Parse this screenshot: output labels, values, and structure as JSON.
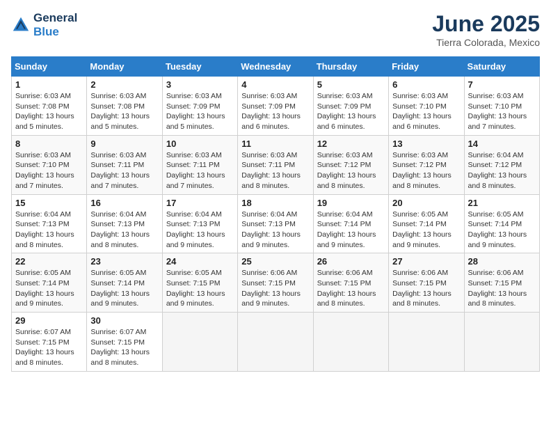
{
  "header": {
    "logo_line1": "General",
    "logo_line2": "Blue",
    "month": "June 2025",
    "location": "Tierra Colorada, Mexico"
  },
  "weekdays": [
    "Sunday",
    "Monday",
    "Tuesday",
    "Wednesday",
    "Thursday",
    "Friday",
    "Saturday"
  ],
  "weeks": [
    [
      {
        "day": "1",
        "sunrise": "Sunrise: 6:03 AM",
        "sunset": "Sunset: 7:08 PM",
        "daylight": "Daylight: 13 hours and 5 minutes."
      },
      {
        "day": "2",
        "sunrise": "Sunrise: 6:03 AM",
        "sunset": "Sunset: 7:08 PM",
        "daylight": "Daylight: 13 hours and 5 minutes."
      },
      {
        "day": "3",
        "sunrise": "Sunrise: 6:03 AM",
        "sunset": "Sunset: 7:09 PM",
        "daylight": "Daylight: 13 hours and 5 minutes."
      },
      {
        "day": "4",
        "sunrise": "Sunrise: 6:03 AM",
        "sunset": "Sunset: 7:09 PM",
        "daylight": "Daylight: 13 hours and 6 minutes."
      },
      {
        "day": "5",
        "sunrise": "Sunrise: 6:03 AM",
        "sunset": "Sunset: 7:09 PM",
        "daylight": "Daylight: 13 hours and 6 minutes."
      },
      {
        "day": "6",
        "sunrise": "Sunrise: 6:03 AM",
        "sunset": "Sunset: 7:10 PM",
        "daylight": "Daylight: 13 hours and 6 minutes."
      },
      {
        "day": "7",
        "sunrise": "Sunrise: 6:03 AM",
        "sunset": "Sunset: 7:10 PM",
        "daylight": "Daylight: 13 hours and 7 minutes."
      }
    ],
    [
      {
        "day": "8",
        "sunrise": "Sunrise: 6:03 AM",
        "sunset": "Sunset: 7:10 PM",
        "daylight": "Daylight: 13 hours and 7 minutes."
      },
      {
        "day": "9",
        "sunrise": "Sunrise: 6:03 AM",
        "sunset": "Sunset: 7:11 PM",
        "daylight": "Daylight: 13 hours and 7 minutes."
      },
      {
        "day": "10",
        "sunrise": "Sunrise: 6:03 AM",
        "sunset": "Sunset: 7:11 PM",
        "daylight": "Daylight: 13 hours and 7 minutes."
      },
      {
        "day": "11",
        "sunrise": "Sunrise: 6:03 AM",
        "sunset": "Sunset: 7:11 PM",
        "daylight": "Daylight: 13 hours and 8 minutes."
      },
      {
        "day": "12",
        "sunrise": "Sunrise: 6:03 AM",
        "sunset": "Sunset: 7:12 PM",
        "daylight": "Daylight: 13 hours and 8 minutes."
      },
      {
        "day": "13",
        "sunrise": "Sunrise: 6:03 AM",
        "sunset": "Sunset: 7:12 PM",
        "daylight": "Daylight: 13 hours and 8 minutes."
      },
      {
        "day": "14",
        "sunrise": "Sunrise: 6:04 AM",
        "sunset": "Sunset: 7:12 PM",
        "daylight": "Daylight: 13 hours and 8 minutes."
      }
    ],
    [
      {
        "day": "15",
        "sunrise": "Sunrise: 6:04 AM",
        "sunset": "Sunset: 7:13 PM",
        "daylight": "Daylight: 13 hours and 8 minutes."
      },
      {
        "day": "16",
        "sunrise": "Sunrise: 6:04 AM",
        "sunset": "Sunset: 7:13 PM",
        "daylight": "Daylight: 13 hours and 8 minutes."
      },
      {
        "day": "17",
        "sunrise": "Sunrise: 6:04 AM",
        "sunset": "Sunset: 7:13 PM",
        "daylight": "Daylight: 13 hours and 9 minutes."
      },
      {
        "day": "18",
        "sunrise": "Sunrise: 6:04 AM",
        "sunset": "Sunset: 7:13 PM",
        "daylight": "Daylight: 13 hours and 9 minutes."
      },
      {
        "day": "19",
        "sunrise": "Sunrise: 6:04 AM",
        "sunset": "Sunset: 7:14 PM",
        "daylight": "Daylight: 13 hours and 9 minutes."
      },
      {
        "day": "20",
        "sunrise": "Sunrise: 6:05 AM",
        "sunset": "Sunset: 7:14 PM",
        "daylight": "Daylight: 13 hours and 9 minutes."
      },
      {
        "day": "21",
        "sunrise": "Sunrise: 6:05 AM",
        "sunset": "Sunset: 7:14 PM",
        "daylight": "Daylight: 13 hours and 9 minutes."
      }
    ],
    [
      {
        "day": "22",
        "sunrise": "Sunrise: 6:05 AM",
        "sunset": "Sunset: 7:14 PM",
        "daylight": "Daylight: 13 hours and 9 minutes."
      },
      {
        "day": "23",
        "sunrise": "Sunrise: 6:05 AM",
        "sunset": "Sunset: 7:14 PM",
        "daylight": "Daylight: 13 hours and 9 minutes."
      },
      {
        "day": "24",
        "sunrise": "Sunrise: 6:05 AM",
        "sunset": "Sunset: 7:15 PM",
        "daylight": "Daylight: 13 hours and 9 minutes."
      },
      {
        "day": "25",
        "sunrise": "Sunrise: 6:06 AM",
        "sunset": "Sunset: 7:15 PM",
        "daylight": "Daylight: 13 hours and 9 minutes."
      },
      {
        "day": "26",
        "sunrise": "Sunrise: 6:06 AM",
        "sunset": "Sunset: 7:15 PM",
        "daylight": "Daylight: 13 hours and 8 minutes."
      },
      {
        "day": "27",
        "sunrise": "Sunrise: 6:06 AM",
        "sunset": "Sunset: 7:15 PM",
        "daylight": "Daylight: 13 hours and 8 minutes."
      },
      {
        "day": "28",
        "sunrise": "Sunrise: 6:06 AM",
        "sunset": "Sunset: 7:15 PM",
        "daylight": "Daylight: 13 hours and 8 minutes."
      }
    ],
    [
      {
        "day": "29",
        "sunrise": "Sunrise: 6:07 AM",
        "sunset": "Sunset: 7:15 PM",
        "daylight": "Daylight: 13 hours and 8 minutes."
      },
      {
        "day": "30",
        "sunrise": "Sunrise: 6:07 AM",
        "sunset": "Sunset: 7:15 PM",
        "daylight": "Daylight: 13 hours and 8 minutes."
      },
      {
        "day": "",
        "sunrise": "",
        "sunset": "",
        "daylight": ""
      },
      {
        "day": "",
        "sunrise": "",
        "sunset": "",
        "daylight": ""
      },
      {
        "day": "",
        "sunrise": "",
        "sunset": "",
        "daylight": ""
      },
      {
        "day": "",
        "sunrise": "",
        "sunset": "",
        "daylight": ""
      },
      {
        "day": "",
        "sunrise": "",
        "sunset": "",
        "daylight": ""
      }
    ]
  ]
}
